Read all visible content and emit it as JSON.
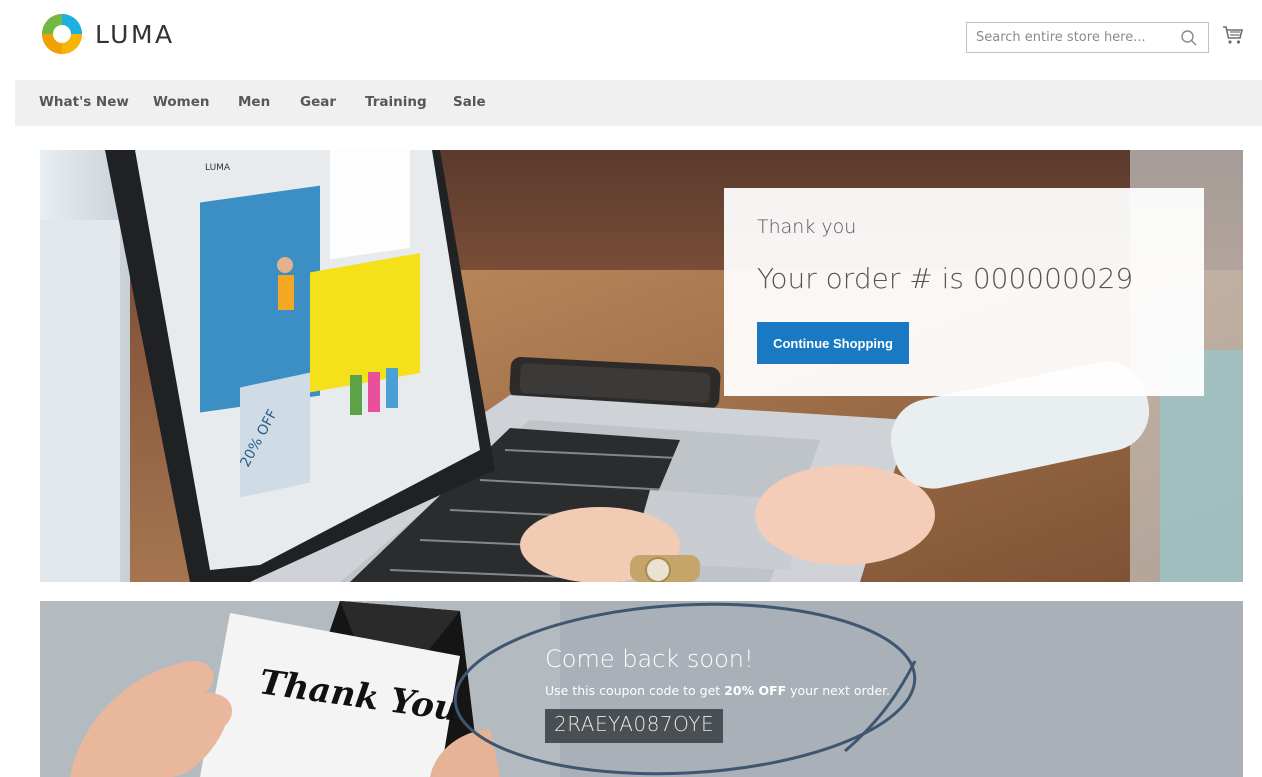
{
  "brand": {
    "name": "LUMA"
  },
  "search": {
    "placeholder": "Search entire store here..."
  },
  "nav": {
    "items": [
      {
        "label": "What's New"
      },
      {
        "label": "Women"
      },
      {
        "label": "Men"
      },
      {
        "label": "Gear"
      },
      {
        "label": "Training"
      },
      {
        "label": "Sale"
      }
    ]
  },
  "hero": {
    "thank_you": "Thank you",
    "order_text": "Your order # is 000000029",
    "continue_label": "Continue Shopping",
    "laptop_screen": {
      "brand": "LUMA",
      "promo": "20% OFF"
    }
  },
  "banner": {
    "card_text": "Thank You",
    "heading": "Come back soon!",
    "coupon_prefix": "Use this coupon code to get ",
    "coupon_bold": "20% OFF",
    "coupon_suffix": " your next order.",
    "coupon_code": "2RAEYA087OYE"
  },
  "colors": {
    "accent": "#1979c3",
    "nav_bg": "#f0f0f0",
    "banner_bg": "#a9b0b7",
    "coupon_bg": "#4a4f54"
  },
  "icons": {
    "search": "search-icon",
    "cart": "cart-icon",
    "logo": "luma-logo-icon"
  }
}
